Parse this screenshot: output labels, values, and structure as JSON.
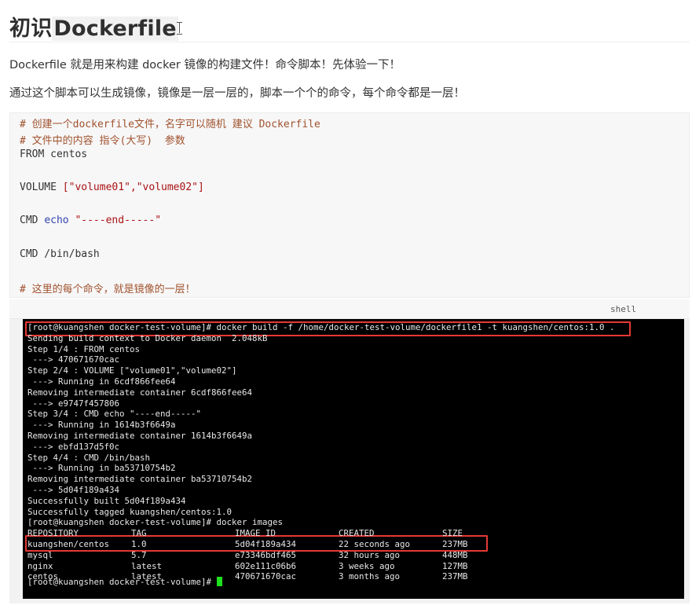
{
  "heading": {
    "prefix": "初识",
    "highlight": "Dockerfile"
  },
  "paragraphs": [
    "Dockerfile 就是用来构建 docker 镜像的构建文件！命令脚本！先体验一下！",
    "通过这个脚本可以生成镜像，镜像是一层一层的，脚本一个个的命令，每个命令都是一层！"
  ],
  "code": {
    "language": "shell",
    "comment1": "# 创建一个dockerfile文件，名字可以随机 建议 Dockerfile",
    "comment2": "# 文件中的内容 指令(大写)  参数",
    "from": "FROM centos",
    "volume_kw": "VOLUME ",
    "volume_args": "[\"volume01\",\"volume02\"]",
    "cmd1_kw": "CMD ",
    "cmd1_echo": "echo",
    "cmd1_str": " \"----end-----\"",
    "cmd2": "CMD /bin/bash",
    "comment3": "# 这里的每个命令，就是镜像的一层！"
  },
  "terminal": {
    "lines": [
      "[root@kuangshen docker-test-volume]# docker build -f /home/docker-test-volume/dockerfile1 -t kuangshen/centos:1.0 .",
      "Sending build context to Docker daemon  2.048kB",
      "Step 1/4 : FROM centos",
      " ---> 470671670cac",
      "Step 2/4 : VOLUME [\"volume01\",\"volume02\"]",
      " ---> Running in 6cdf866fee64",
      "Removing intermediate container 6cdf866fee64",
      " ---> e9747f457806",
      "Step 3/4 : CMD echo \"----end-----\"",
      " ---> Running in 1614b3f6649a",
      "Removing intermediate container 1614b3f6649a",
      " ---> ebfd137d5f0c",
      "Step 4/4 : CMD /bin/bash",
      " ---> Running in ba53710754b2",
      "Removing intermediate container ba53710754b2",
      " ---> 5d04f189a434",
      "Successfully built 5d04f189a434",
      "Successfully tagged kuangshen/centos:1.0",
      "[root@kuangshen docker-test-volume]# docker images"
    ],
    "images_header": [
      "REPOSITORY",
      "TAG",
      "IMAGE ID",
      "CREATED",
      "SIZE"
    ],
    "images_rows": [
      [
        "kuangshen/centos",
        "1.0",
        "5d04f189a434",
        "22 seconds ago",
        "237MB"
      ],
      [
        "mysql",
        "5.7",
        "e73346bdf465",
        "32 hours ago",
        "448MB"
      ],
      [
        "nginx",
        "latest",
        "602e111c06b6",
        "3 weeks ago",
        "127MB"
      ],
      [
        "centos",
        "latest",
        "470671670cac",
        "3 months ago",
        "237MB"
      ]
    ],
    "final_prompt": "[root@kuangshen docker-test-volume]# "
  }
}
